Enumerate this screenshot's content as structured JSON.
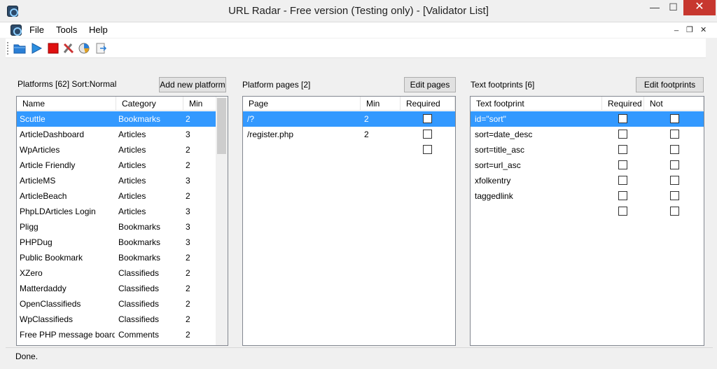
{
  "window": {
    "title": "URL Radar - Free version (Testing only) - [Validator List]",
    "min_glyph": "—",
    "max_glyph": "☐",
    "close_glyph": "✕"
  },
  "menu": {
    "items": [
      "File",
      "Tools",
      "Help"
    ],
    "mdi_min": "_",
    "mdi_restore": "❐",
    "mdi_close": "✕"
  },
  "toolbar": {
    "icons": [
      "open-folder-icon",
      "play-icon",
      "stop-icon",
      "tools-icon",
      "chart-icon",
      "export-icon"
    ]
  },
  "platforms": {
    "label": "Platforms [62] Sort:Normal",
    "button": "Add new platform",
    "columns": [
      "Name",
      "Category",
      "Min"
    ],
    "rows": [
      {
        "name": "Scuttle",
        "category": "Bookmarks",
        "min": "2"
      },
      {
        "name": "ArticleDashboard",
        "category": "Articles",
        "min": "3"
      },
      {
        "name": "WpArticles",
        "category": "Articles",
        "min": "2"
      },
      {
        "name": "Article Friendly",
        "category": "Articles",
        "min": "2"
      },
      {
        "name": "ArticleMS",
        "category": "Articles",
        "min": "3"
      },
      {
        "name": "ArticleBeach",
        "category": "Articles",
        "min": "2"
      },
      {
        "name": "PhpLDArticles Login",
        "category": "Articles",
        "min": "3"
      },
      {
        "name": "Pligg",
        "category": "Bookmarks",
        "min": "3"
      },
      {
        "name": "PHPDug",
        "category": "Bookmarks",
        "min": "3"
      },
      {
        "name": "Public Bookmark",
        "category": "Bookmarks",
        "min": "2"
      },
      {
        "name": "XZero",
        "category": "Classifieds",
        "min": "2"
      },
      {
        "name": "Matterdaddy",
        "category": "Classifieds",
        "min": "2"
      },
      {
        "name": "OpenClassifieds",
        "category": "Classifieds",
        "min": "2"
      },
      {
        "name": "WpClassifieds",
        "category": "Classifieds",
        "min": "2"
      },
      {
        "name": "Free PHP message board",
        "category": "Comments",
        "min": "2"
      }
    ]
  },
  "pages": {
    "label": "Platform pages [2]",
    "button": "Edit pages",
    "columns": [
      "Page",
      "Min",
      "Required"
    ],
    "rows": [
      {
        "page": "/?",
        "min": "2"
      },
      {
        "page": "/register.php",
        "min": "2"
      },
      {
        "page": "",
        "min": ""
      }
    ]
  },
  "footprints": {
    "label": "Text footprints [6]",
    "button": "Edit footprints",
    "columns": [
      "Text footprint",
      "Required",
      "Not"
    ],
    "rows": [
      {
        "text": "id=\"sort\""
      },
      {
        "text": "sort=date_desc"
      },
      {
        "text": "sort=title_asc"
      },
      {
        "text": "sort=url_asc"
      },
      {
        "text": "xfolkentry"
      },
      {
        "text": "taggedlink"
      },
      {
        "text": ""
      }
    ]
  },
  "status": {
    "text": "Done."
  },
  "colors": {
    "selection": "#3399ff",
    "close_button": "#c7372f"
  }
}
